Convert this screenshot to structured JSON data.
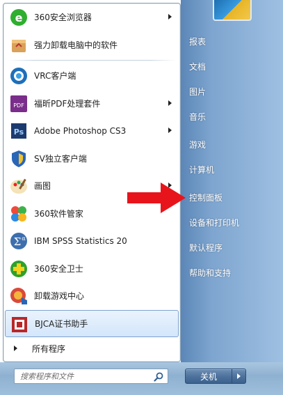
{
  "programs": [
    {
      "label": "360安全浏览器",
      "icon": "360-browser-icon",
      "submenu": true
    },
    {
      "label": "强力卸载电脑中的软件",
      "icon": "uninstall-box-icon",
      "submenu": false
    },
    {
      "label": "VRC客户端",
      "icon": "vrc-client-icon",
      "submenu": false
    },
    {
      "label": "福昕PDF处理套件",
      "icon": "foxit-pdf-icon",
      "submenu": true
    },
    {
      "label": "Adobe Photoshop CS3",
      "icon": "photoshop-icon",
      "submenu": true
    },
    {
      "label": "SV独立客户端",
      "icon": "sv-shield-icon",
      "submenu": false
    },
    {
      "label": "画图",
      "icon": "paint-palette-icon",
      "submenu": true
    },
    {
      "label": "360软件管家",
      "icon": "360-software-manager-icon",
      "submenu": false
    },
    {
      "label": "IBM SPSS Statistics 20",
      "icon": "spss-icon",
      "submenu": false
    },
    {
      "label": "360安全卫士",
      "icon": "360-security-icon",
      "submenu": false
    },
    {
      "label": "卸载游戏中心",
      "icon": "game-center-uninstall-icon",
      "submenu": false
    },
    {
      "label": "BJCA证书助手",
      "icon": "bjca-certificate-icon",
      "submenu": false,
      "selected": true
    }
  ],
  "all_programs": "所有程序",
  "search": {
    "placeholder": "搜索程序和文件"
  },
  "right_links": [
    "报表",
    "文档",
    "图片",
    "音乐",
    "游戏",
    "计算机",
    "控制面板",
    "设备和打印机",
    "默认程序",
    "帮助和支持"
  ],
  "shutdown": {
    "label": "关机"
  },
  "colors": {
    "annotation_arrow": "#e8141c",
    "right_pane": "#7ea5cf",
    "selection": "#d3e6fb"
  }
}
